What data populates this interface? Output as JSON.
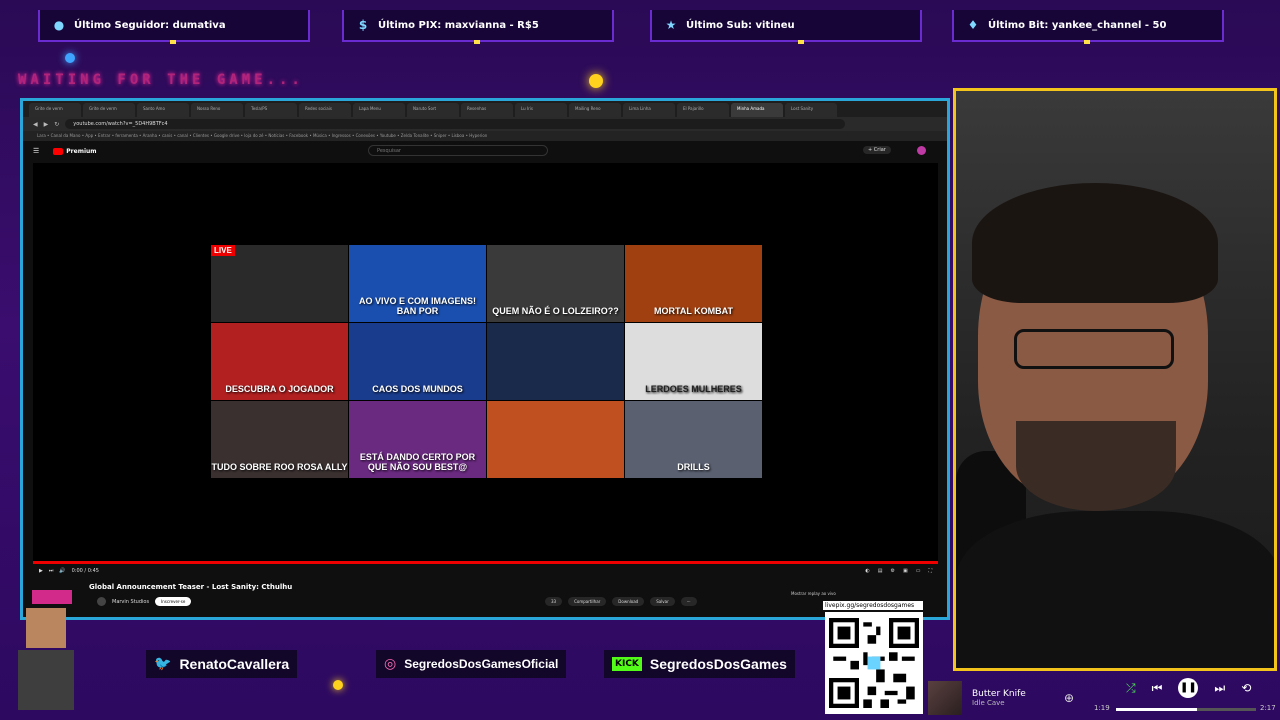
{
  "alerts": [
    {
      "icon": "user-icon",
      "text": "Último Seguidor: dumativa"
    },
    {
      "icon": "pix-icon",
      "text": "Último PIX: maxvianna - R$5"
    },
    {
      "icon": "star-icon",
      "text": "Último Sub: vitineu"
    },
    {
      "icon": "diamond-icon",
      "text": "Último Bit: yankee_channel - 50"
    }
  ],
  "waiting_text": "WAITING FOR THE GAME...",
  "browser": {
    "tabs": [
      "Grite de verm",
      "Grite de verm",
      "Santo Amo",
      "Nosso Reno",
      "Tesla/PS",
      "Redes sociais",
      "Lapa Menu",
      "Naruto Sort",
      "Resenhas",
      "Lu Iris",
      "Mailing Reno",
      "Lima Linha",
      "El Pajarillo",
      "Minha Amada",
      "Lost Sanity"
    ],
    "active_tab": 13,
    "url": "youtube.com/watch?v=_5D4H9BTFc4",
    "bookmarks": "Lara • Canal da Mano • App • Entrar • ferramenta • Aranha • canis • canal • Clientes • Google drive • loja do zé • Notícias • Facebook • Música • Ingressos • Conexões • Youtube • Zelda Tonalite • Sniper • Lisboa • Hyperion"
  },
  "youtube": {
    "logo": "Premium",
    "search_placeholder": "Pesquisar",
    "create_label": "+ Criar",
    "thumbnails": [
      {
        "label": "",
        "live": "LIVE",
        "bg": "#2a2a2a"
      },
      {
        "label": "AO VIVO E COM IMAGENS! BAN POR",
        "live": "",
        "bg": "#1a4fb0"
      },
      {
        "label": "QUEM NÃO É O LOLZEIRO??",
        "live": "",
        "bg": "#3a3a3a"
      },
      {
        "label": "MORTAL KOMBAT",
        "live": "",
        "bg": "#a04010"
      },
      {
        "label": "DESCUBRA O JOGADOR",
        "live": "",
        "bg": "#b22020"
      },
      {
        "label": "CAOS DOS MUNDOS",
        "live": "",
        "bg": "#1a3c8c"
      },
      {
        "label": "",
        "live": "",
        "bg": "#1a2a4a"
      },
      {
        "label": "LERDOES MULHERES",
        "live": "",
        "bg": "#dddddd"
      },
      {
        "label": "TUDO SOBRE ROO ROSA ALLY",
        "live": "",
        "bg": "#3a3030"
      },
      {
        "label": "ESTÁ DANDO CERTO POR QUE NÃO SOU BEST@",
        "live": "",
        "bg": "#6a2a80"
      },
      {
        "label": "",
        "live": "",
        "bg": "#c05020"
      },
      {
        "label": "DRILLS",
        "live": "",
        "bg": "#5a6070"
      }
    ],
    "time": "0:00 / 0:45",
    "video_title": "Global Announcement Teaser - Lost Sanity: Cthulhu",
    "channel_name": "Marvin Studios",
    "subscribe": "Inscrever-se",
    "likes": "33",
    "share": "Compartilhar",
    "download": "Download",
    "save": "Salvar",
    "more": "···",
    "hint": "Mostrar replay ao vivo"
  },
  "social": {
    "twitter": "RenatoCavallera",
    "instagram": "SegredosDosGamesOficial",
    "kick_badge": "KICK",
    "kick": "SegredosDosGames",
    "qr_url": "livepix.gg/segredosdosgames"
  },
  "music": {
    "title": "Butter Knife",
    "artist": "Idle Cave",
    "elapsed": "1:19",
    "total": "2:17",
    "progress": 0.58
  },
  "colors": {
    "webcam_border": "#f3c41c",
    "browser_border": "#2aa6d8",
    "accent_pink": "#d22a8a"
  }
}
